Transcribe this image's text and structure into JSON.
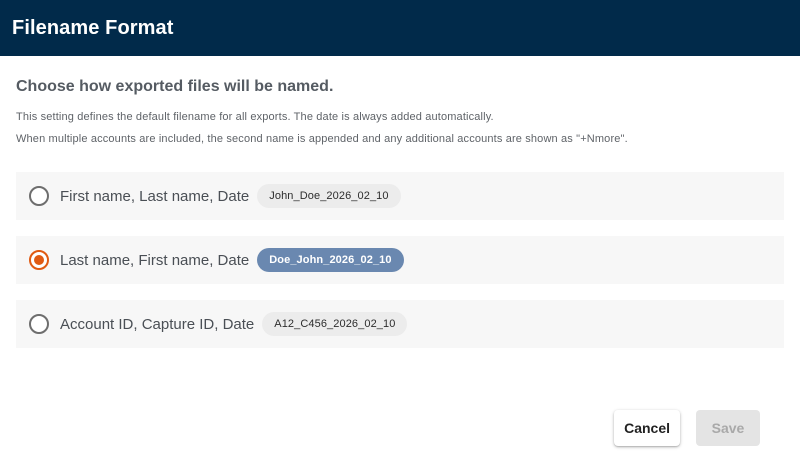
{
  "dialog": {
    "title": "Filename Format",
    "subtitle": "Choose how exported files will be named.",
    "description_line1": "This setting defines the default filename for all exports. The date is always added automatically.",
    "description_line2": "When multiple accounts are included, the second name is appended and any additional accounts are shown as \"+Nmore\"."
  },
  "options": [
    {
      "label": "First name, Last name, Date",
      "example": "John_Doe_2026_02_10",
      "selected": false
    },
    {
      "label": "Last name, First name, Date",
      "example": "Doe_John_2026_02_10",
      "selected": true
    },
    {
      "label": "Account ID, Capture ID, Date",
      "example": "A12_C456_2026_02_10",
      "selected": false
    }
  ],
  "actions": {
    "cancel_label": "Cancel",
    "save_label": "Save",
    "save_disabled": true
  },
  "colors": {
    "header_bg": "#012a4a",
    "accent_radio": "#e05a12",
    "selected_chip_bg": "#6a88b0"
  }
}
